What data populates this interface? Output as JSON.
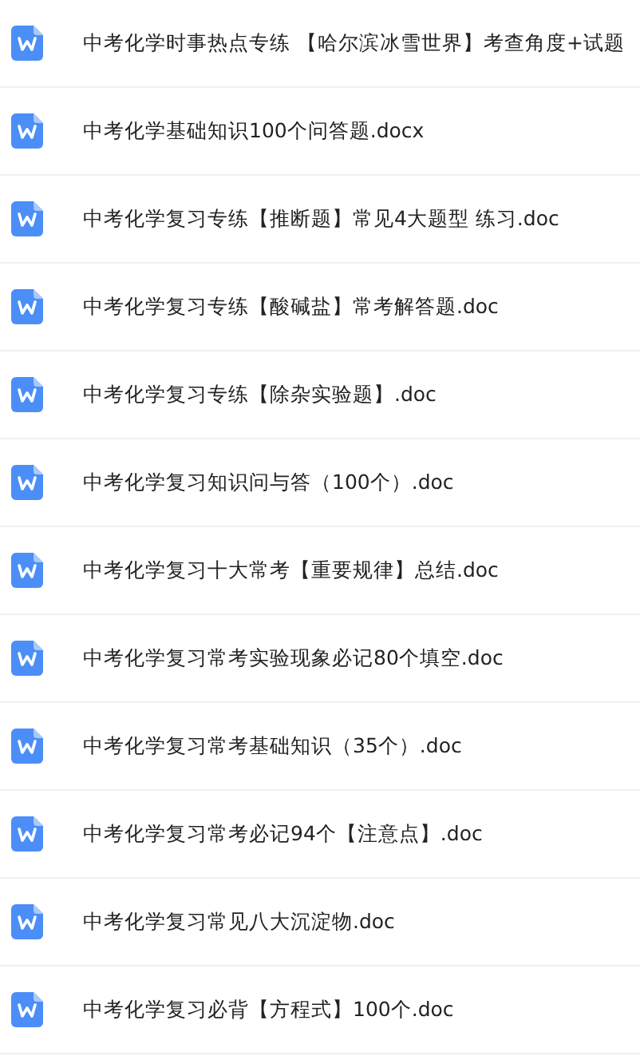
{
  "files": [
    {
      "name": "中考化学时事热点专练 【哈尔滨冰雪世界】考查角度+试题"
    },
    {
      "name": "中考化学基础知识100个问答题.docx"
    },
    {
      "name": "中考化学复习专练【推断题】常见4大题型 练习.doc"
    },
    {
      "name": "中考化学复习专练【酸碱盐】常考解答题.doc"
    },
    {
      "name": "中考化学复习专练【除杂实验题】.doc"
    },
    {
      "name": "中考化学复习知识问与答（100个）.doc"
    },
    {
      "name": "中考化学复习十大常考【重要规律】总结.doc"
    },
    {
      "name": "中考化学复习常考实验现象必记80个填空.doc"
    },
    {
      "name": "中考化学复习常考基础知识（35个）.doc"
    },
    {
      "name": "中考化学复习常考必记94个【注意点】.doc"
    },
    {
      "name": "中考化学复习常见八大沉淀物.doc"
    },
    {
      "name": "中考化学复习必背【方程式】100个.doc"
    }
  ]
}
